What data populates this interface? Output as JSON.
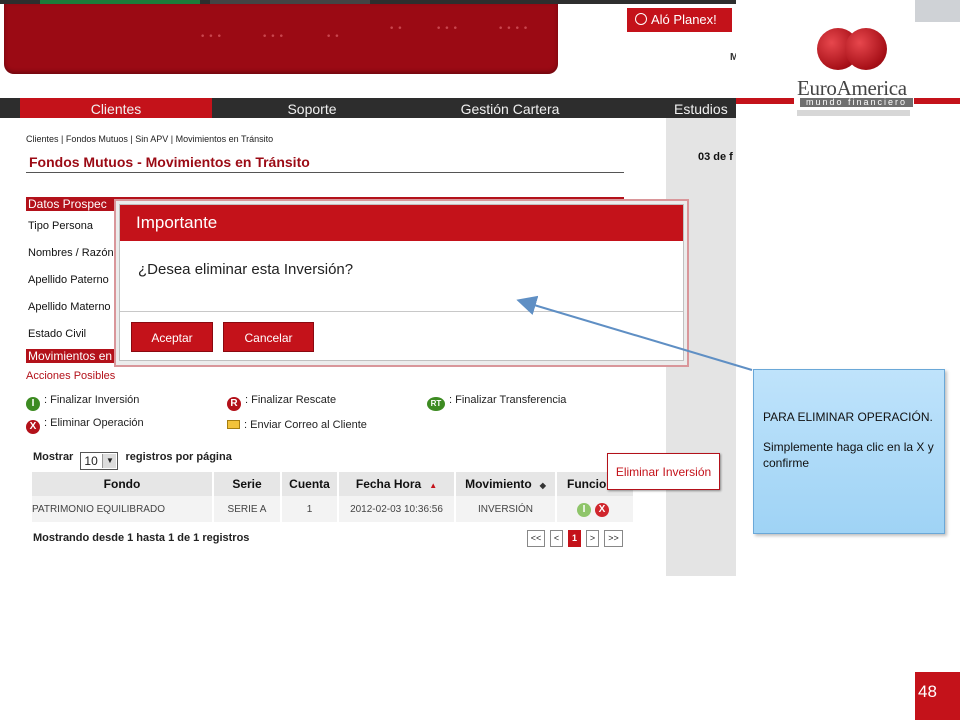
{
  "app": {
    "alo_planex": "Aló Planex!",
    "top_right_fragment": "M",
    "nav": [
      "Clientes",
      "Soporte",
      "Gestión Cartera",
      "Estudios"
    ],
    "breadcrumb": "Clientes | Fondos Mutuos | Sin APV | Movimientos en Tránsito",
    "page_title": "Fondos Mutuos - Movimientos en Tránsito",
    "date_fragment": "03 de f",
    "section_datos": "Datos Prospec",
    "fields": [
      "Tipo Persona",
      "Nombres / Razón",
      "Apellido Paterno",
      "Apellido Materno",
      "Estado Civil"
    ],
    "section_movimientos": "Movimientos en",
    "acciones_title": "Acciones Posibles",
    "legend": [
      {
        "icon": "I",
        "label": ": Finalizar Inversión"
      },
      {
        "icon": "R",
        "label": ": Finalizar Rescate"
      },
      {
        "icon": "RT",
        "label": ": Finalizar Transferencia"
      },
      {
        "icon": "X",
        "label": ": Eliminar Operación"
      },
      {
        "icon": "envelope",
        "label": ": Enviar Correo al Cliente"
      }
    ],
    "mostrar_label": "Mostrar",
    "per_page_value": "10",
    "registros_label": "registros por página",
    "table": {
      "headers": [
        "Fondo",
        "Serie",
        "Cuenta",
        "Fecha Hora",
        "Movimiento",
        "Funciones"
      ],
      "rows": [
        [
          "PATRIMONIO EQUILIBRADO",
          "SERIE A",
          "1",
          "2012-02-03 10:36:56",
          "INVERSIÓN"
        ]
      ]
    },
    "showing_text": "Mostrando desde 1 hasta 1 de 1 registros",
    "pager": [
      "<<",
      "<",
      "1",
      ">",
      ">>"
    ],
    "callout": "Eliminar Inversión"
  },
  "modal": {
    "title": "Importante",
    "message": "¿Desea eliminar esta Inversión?",
    "accept": "Aceptar",
    "cancel": "Cancelar"
  },
  "brand": {
    "name": "EuroAmerica",
    "tagline": "mundo financiero"
  },
  "instruction": {
    "line1": "PARA ELIMINAR OPERACIÓN.",
    "line2": "Simplemente haga clic en la X y confirme"
  },
  "slide_number": "48",
  "colors": {
    "brand_red": "#c4121a",
    "banner_red": "#9b0a14",
    "nav_dark": "#2d2d2d",
    "info_blue": "#aad9f7"
  }
}
